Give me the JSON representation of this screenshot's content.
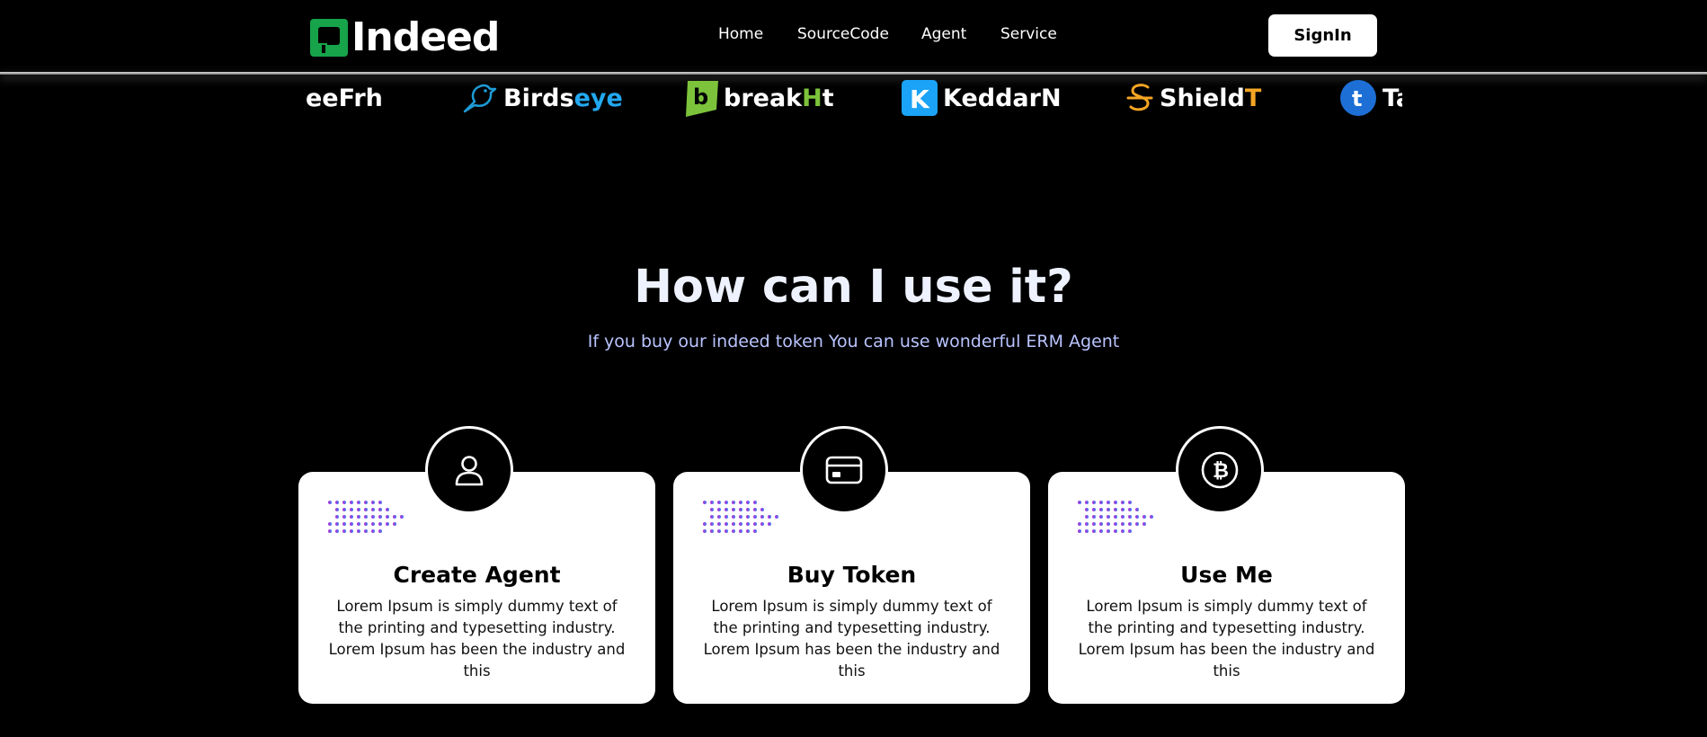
{
  "brand": {
    "name": "Indeed",
    "accent": "#16a34a"
  },
  "nav": {
    "links": [
      {
        "label": "Home"
      },
      {
        "label": "SourceCode"
      },
      {
        "label": "Agent"
      },
      {
        "label": "Service"
      }
    ],
    "signin_label": "SignIn"
  },
  "partners": [
    {
      "name": "eeFrh",
      "icon": "none"
    },
    {
      "name_main": "Birds",
      "name_accent": "eye",
      "accent_color": "#22a8f0",
      "icon": "bird-icon"
    },
    {
      "name_main": "break",
      "name_accent": "H",
      "name_rest": "t",
      "accent_color": "#7cc33b",
      "icon": "b-badge-icon"
    },
    {
      "name": "KeddarN",
      "icon": "k-square-icon",
      "icon_color": "#1aa3f7"
    },
    {
      "name_main": "Shield",
      "name_accent": "T",
      "accent_color": "#f5a524",
      "icon": "s-strike-icon"
    },
    {
      "name": "Ta",
      "icon": "t-circle-icon",
      "icon_color": "#1d6fd6"
    }
  ],
  "hero": {
    "title": "How can I use it?",
    "subtitle": "If you buy our indeed token You can use wonderful ERM Agent"
  },
  "cards": [
    {
      "title": "Create Agent",
      "icon": "user-icon",
      "text": "Lorem Ipsum is simply dummy text of the printing and typesetting industry. Lorem Ipsum has been the industry and this"
    },
    {
      "title": "Buy Token",
      "icon": "credit-card-icon",
      "text": "Lorem Ipsum is simply dummy text of the printing and typesetting industry. Lorem Ipsum has been the industry and this"
    },
    {
      "title": "Use Me",
      "icon": "bitcoin-icon",
      "text": "Lorem Ipsum is simply dummy text of the printing and typesetting industry. Lorem Ipsum has been the industry and this"
    }
  ]
}
